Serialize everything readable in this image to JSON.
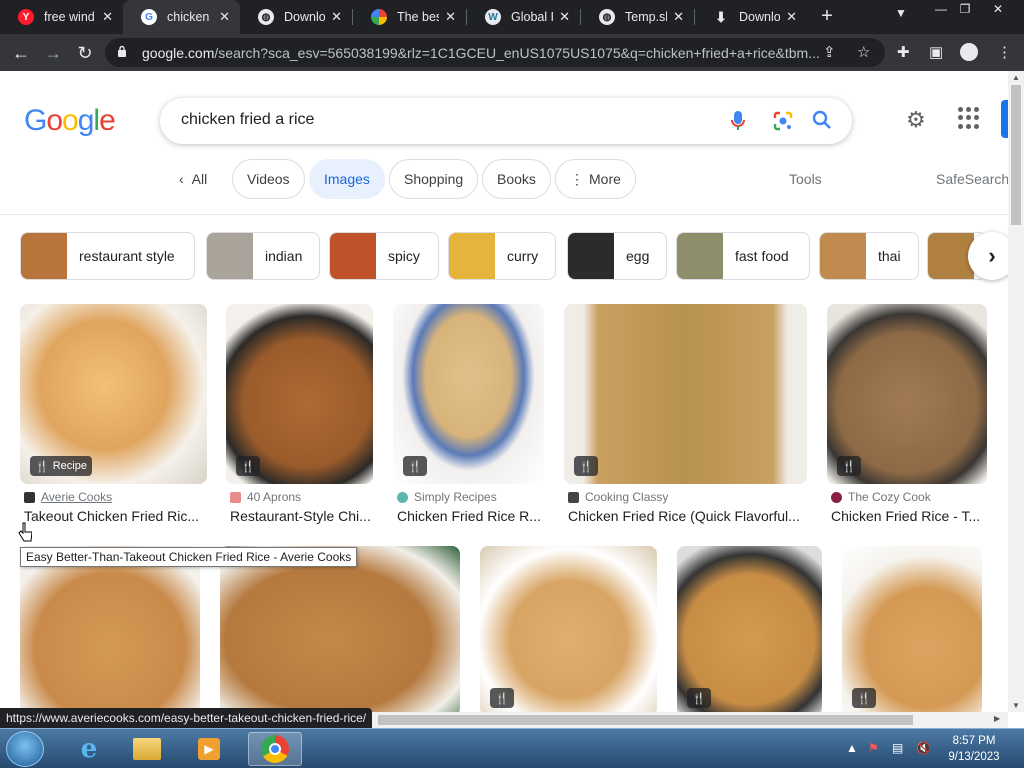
{
  "browser": {
    "tabs": [
      {
        "title": "free wind",
        "favicon_color": "#ff1b2d",
        "favicon_glyph": "Y",
        "active": false
      },
      {
        "title": "chicken fr",
        "favicon_color": "#ffffff",
        "favicon_glyph": "G",
        "active": true
      },
      {
        "title": "Downloa",
        "favicon_color": "#ffffff",
        "favicon_glyph": "globe-icon",
        "active": false
      },
      {
        "title": "The best",
        "favicon_color": "#34a853",
        "favicon_glyph": "multicolor-icon",
        "active": false
      },
      {
        "title": "Global PC",
        "favicon_color": "#ffffff",
        "favicon_glyph": "W",
        "active": false
      },
      {
        "title": "Temp.sh |",
        "favicon_color": "#ffffff",
        "favicon_glyph": "globe-icon",
        "active": false
      },
      {
        "title": "Downloa",
        "favicon_color": "#ffffff",
        "favicon_glyph": "download-icon",
        "active": false
      }
    ],
    "url_domain": "google.com",
    "url_rest": "/search?sca_esv=565038199&rlz=1C1GCEU_enUS1075US1075&q=chicken+fried+a+rice&tbm...",
    "status_url": "https://www.averiecooks.com/easy-better-takeout-chicken-fried-rice/"
  },
  "search": {
    "query": "chicken fried a rice",
    "logo_text": [
      "G",
      "o",
      "o",
      "g",
      "l",
      "e"
    ],
    "logo_colors": [
      "#4285f4",
      "#ea4335",
      "#fbbc05",
      "#4285f4",
      "#34a853",
      "#ea4335"
    ]
  },
  "filters": {
    "all": "All",
    "chips": [
      "Videos",
      "Images",
      "Shopping",
      "Books",
      "More"
    ],
    "selected": "Images",
    "tools": "Tools",
    "safesearch": "SafeSearch"
  },
  "refinements": [
    {
      "label": "restaurant style",
      "color": "#b8743a"
    },
    {
      "label": "indian",
      "color": "#a9a39a"
    },
    {
      "label": "spicy",
      "color": "#c0522b"
    },
    {
      "label": "curry",
      "color": "#e6b43a"
    },
    {
      "label": "egg",
      "color": "#2d2b29"
    },
    {
      "label": "fast food",
      "color": "#8f8e6b"
    },
    {
      "label": "thai",
      "color": "#c08a4f"
    }
  ],
  "results_row1": [
    {
      "source": "Averie Cooks",
      "title": "Takeout Chicken Fried Ric...",
      "badge": "Recipe",
      "color": "#e0a55f",
      "fav": "#333333"
    },
    {
      "source": "40 Aprons",
      "title": "Restaurant-Style Chi...",
      "badge": "",
      "color": "#9a5b2b",
      "fav": "#e88b8b"
    },
    {
      "source": "Simply Recipes",
      "title": "Chicken Fried Rice R...",
      "badge": "",
      "color": "#d8b47c",
      "fav": "#5bb5b0"
    },
    {
      "source": "Cooking Classy",
      "title": "Chicken Fried Rice (Quick Flavorful...",
      "badge": "",
      "color": "#c9a060",
      "fav": "#444444"
    },
    {
      "source": "The Cozy Cook",
      "title": "Chicken Fried Rice - T...",
      "badge": "",
      "color": "#8d6a45",
      "fav": "#8b2142"
    }
  ],
  "results_row2_colors": [
    "#c98a4a",
    "#b5793e",
    "#d7a463",
    "#c88d45",
    "#d49a55"
  ],
  "tooltip": "Easy Better-Than-Takeout Chicken Fried Rice - Averie Cooks",
  "taskbar": {
    "time": "8:57 PM",
    "date": "9/13/2023"
  }
}
